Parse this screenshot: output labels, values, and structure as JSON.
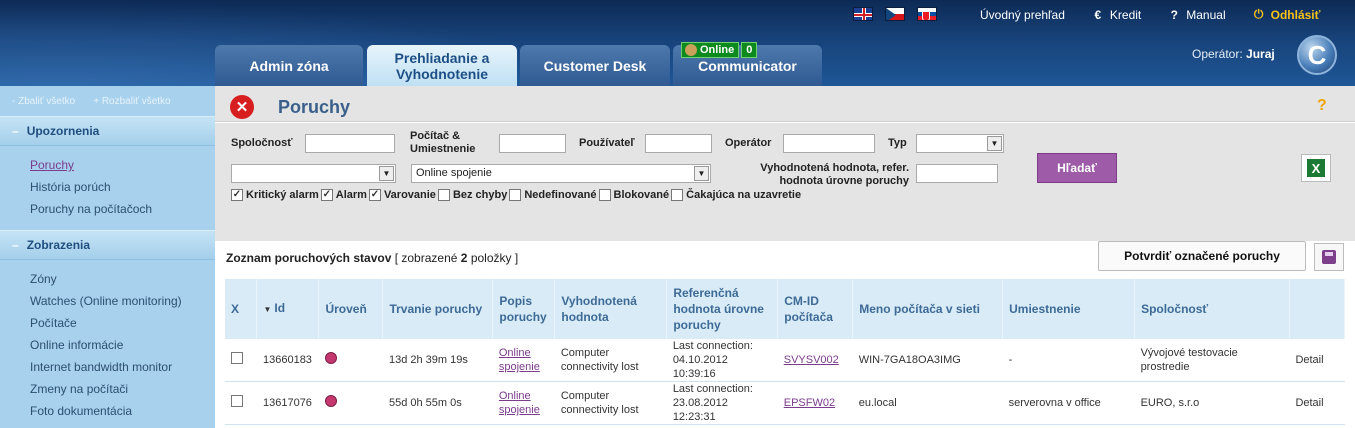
{
  "header": {
    "languages": [
      "uk-flag-icon",
      "cz-flag-icon",
      "sk-flag-icon"
    ],
    "links": [
      {
        "label": "Úvodný prehľad",
        "icon": "home-icon"
      },
      {
        "label": "Kredit",
        "icon": "euro-icon"
      },
      {
        "label": "Manual",
        "icon": "question-icon"
      },
      {
        "label": "Odhlásiť",
        "icon": "power-icon"
      }
    ],
    "tabs": [
      {
        "label": "Admin zóna"
      },
      {
        "label": "Prehliadanie a Vyhodnotenie"
      },
      {
        "label": "Customer Desk"
      },
      {
        "label": "Communicator"
      }
    ],
    "online_label": "Online",
    "online_count": "0",
    "operator_label": "Operátor:",
    "operator_name": "Juraj",
    "logo_letter": "C"
  },
  "sidebar": {
    "collapse_all": "- Zbaliť všetko",
    "expand_all": "+ Rozbaliť všetko",
    "sections": [
      {
        "title": "Upozornenia",
        "items": [
          "Poruchy",
          "História porúch",
          "Poruchy na počítačoch"
        ]
      },
      {
        "title": "Zobrazenia",
        "items": [
          "Zóny",
          "Watches (Online monitoring)",
          "Počítače",
          "Online informácie",
          "Internet bandwidth monitor",
          "Zmeny na počítači",
          "Foto dokumentácia"
        ]
      }
    ],
    "active_item": "Poruchy"
  },
  "panel": {
    "title": "Poruchy",
    "help": "?"
  },
  "filters": {
    "company_label": "Spoločnosť",
    "computer_label": "Počítač & Umiestnenie",
    "user_label": "Používateľ",
    "operator_label": "Operátor",
    "type_label": "Typ",
    "eval_label": "Vyhodnotená hodnota, refer. hodnota úrovne poruchy",
    "status_select_value": "Online spojenie",
    "company_select_value": "",
    "search_button": "Hľadať",
    "checkboxes": [
      {
        "label": "Kritický alarm",
        "checked": true
      },
      {
        "label": "Alarm",
        "checked": true
      },
      {
        "label": "Varovanie",
        "checked": true
      },
      {
        "label": "Bez chyby",
        "checked": false
      },
      {
        "label": "Nedefinované",
        "checked": false
      },
      {
        "label": "Blokované",
        "checked": false
      },
      {
        "label": "Čakajúca na uzavretie",
        "checked": false
      }
    ]
  },
  "list": {
    "title": "Zoznam poruchových stavov",
    "count_prefix": "[ zobrazené",
    "count": "2",
    "count_suffix": "položky ]",
    "confirm_button": "Potvrdiť označené poruchy",
    "columns": [
      "X",
      "Id",
      "Úroveň",
      "Trvanie poruchy",
      "Popis poruchy",
      "Vyhodnotená hodnota",
      "Referenčná hodnota úrovne poruchy",
      "CM-ID počítača",
      "Meno počítača v sieti",
      "Umiestnenie",
      "Spoločnosť",
      ""
    ],
    "rows": [
      {
        "id": "13660183",
        "duration": "13d 2h 39m 19s",
        "desc": "Online spojenie",
        "value": "Computer connectivity lost",
        "ref": "Last connection: 04.10.2012 10:39:16",
        "cmid": "SVYSV002",
        "hostname": "WIN-7GA18OA3IMG",
        "location": "-",
        "company": "Vývojové testovacie prostredie",
        "detail": "Detail"
      },
      {
        "id": "13617076",
        "duration": "55d 0h 55m 0s",
        "desc": "Online spojenie",
        "value": "Computer connectivity lost",
        "ref": "Last connection: 23.08.2012 12:23:31",
        "cmid": "EPSFW02",
        "hostname": "eu.local",
        "location": "serverovna v office",
        "company": "EURO, s.r.o",
        "detail": "Detail"
      }
    ]
  }
}
